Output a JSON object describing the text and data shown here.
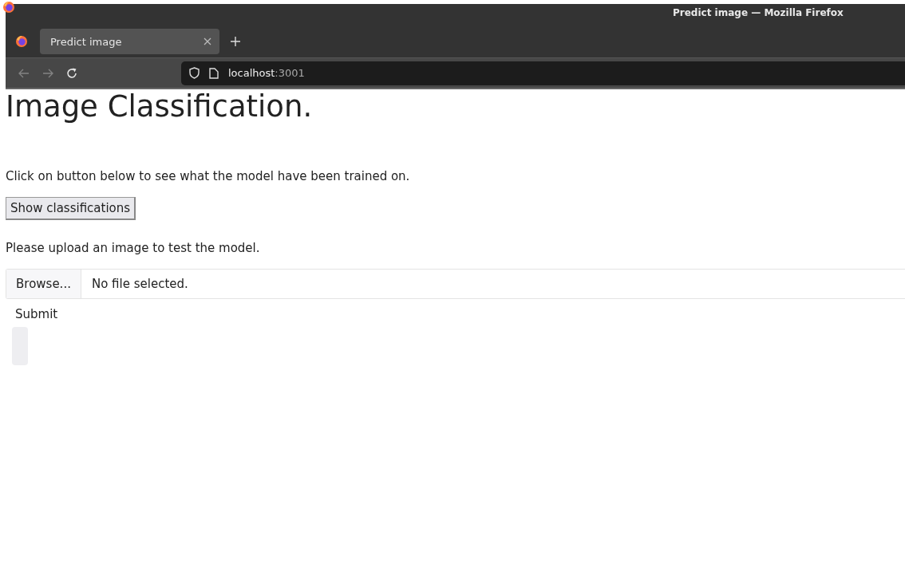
{
  "window": {
    "title": "Predict image — Mozilla Firefox"
  },
  "tabs": [
    {
      "label": "Predict image",
      "selected": true
    }
  ],
  "nav": {
    "back_disabled": true,
    "forward_disabled": true
  },
  "url": {
    "host": "localhost",
    "port": ":3001"
  },
  "page": {
    "heading": "Image Classification.",
    "intro": "Click on button below to see what the model have been trained on.",
    "show_button": "Show classifications",
    "upload_prompt": "Please upload an image to test the model.",
    "file": {
      "button": "Browse...",
      "status": "No file selected."
    },
    "submit": "Submit"
  }
}
